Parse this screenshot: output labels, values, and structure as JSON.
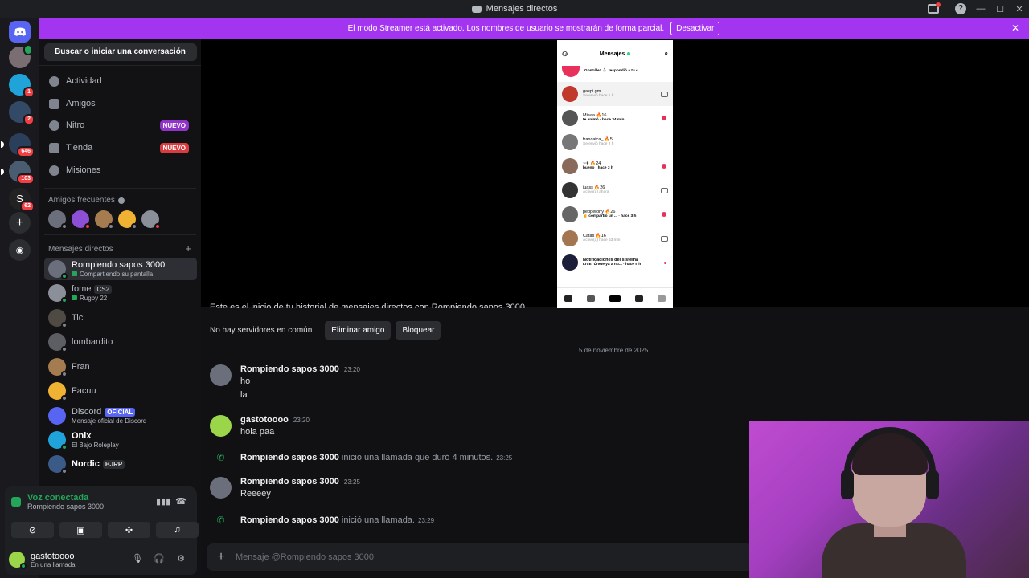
{
  "titlebar": {
    "title": "Mensajes directos"
  },
  "banner": {
    "text": "El modo Streamer está activado. Los nombres de usuario se mostrarán de forma parcial.",
    "button": "Desactivar",
    "close": "✕"
  },
  "guilds": {
    "badges": [
      "1",
      "2",
      "646",
      "103",
      "62"
    ]
  },
  "sidebar": {
    "search": "Buscar o iniciar una conversación",
    "nav": [
      {
        "label": "Actividad",
        "icon": "activity-icon"
      },
      {
        "label": "Amigos",
        "icon": "friends-icon"
      },
      {
        "label": "Nitro",
        "icon": "nitro-icon",
        "badge": "NUEVO"
      },
      {
        "label": "Tienda",
        "icon": "shop-icon",
        "badge": "NUEVO"
      },
      {
        "label": "Misiones",
        "icon": "quests-icon"
      }
    ],
    "frequent_title": "Amigos frecuentes",
    "dm_title": "Mensajes directos",
    "dms": [
      {
        "name": "Rompiendo sapos 3000",
        "sub": "Compartiendo su pantalla",
        "color": "#6b6f7b"
      },
      {
        "name": "fome",
        "tag": "CS2",
        "sub": "Rugby 22",
        "color": "#8b8f99"
      },
      {
        "name": "Tici",
        "sub": "",
        "color": "#4f4a44"
      },
      {
        "name": "lombardito",
        "sub": "",
        "color": "#5d5e63"
      },
      {
        "name": "Fran",
        "sub": "",
        "color": "#a57b50"
      },
      {
        "name": "Facuu",
        "sub": "",
        "color": "#f0b232"
      },
      {
        "name": "Discord",
        "tag": "OFICIAL",
        "sub": "Mensaje oficial de Discord",
        "color": "#5865f2"
      },
      {
        "name": "Onix",
        "sub": "El Bajo Roleplay",
        "color": "#1fa3d8"
      },
      {
        "name": "Nordic",
        "tag": "BJRP",
        "sub": "",
        "color": "#3a5b87"
      }
    ]
  },
  "voice": {
    "title": "Voz conectada",
    "channel": "Rompiendo sapos 3000"
  },
  "user": {
    "name": "gastotoooo",
    "status": "En una llamada"
  },
  "phone": {
    "title": "Mensajes",
    "rows": [
      {
        "name": "González ⛄ respondió a tu c...",
        "sub": "",
        "color": "#e8315a"
      },
      {
        "name": "gaspi.gm",
        "sub": "Se envió hace 1 h",
        "color": "#c0392b"
      },
      {
        "name": "Miaaa 🔥16",
        "sub": "te animó · hace 34 min",
        "color": "#555"
      },
      {
        "name": "francaica_ 🔥5",
        "sub": "Se envió hace 2 h",
        "color": "#777"
      },
      {
        "name": "~✈ 🔥24",
        "sub": "bueno · hace 3 h",
        "color": "#8a6a5a"
      },
      {
        "name": "juass 🔥26",
        "sub": "Activo(a) ahora",
        "color": "#333"
      },
      {
        "name": "pepperony 🔥26",
        "sub": "✌ compartió un ... · hace 3 h",
        "color": "#666"
      },
      {
        "name": "Catas 🔥16",
        "sub": "Activo(a) hace 53 min",
        "color": "#a47551"
      },
      {
        "name": "Notificaciones del sistema",
        "sub": "LIVE: Únete ya a nu... · hace 5 h",
        "color": "#1d1f3a"
      }
    ]
  },
  "conversation": {
    "intro": "Este es el inicio de tu historial de mensajes directos con Rompiendo sapos 3000.",
    "no_common": "No hay servidores en común",
    "remove_friend": "Eliminar amigo",
    "block": "Bloquear",
    "date": "5 de noviembre de 2025",
    "messages": [
      {
        "author": "Rompiendo sapos 3000",
        "time": "23:20",
        "lines": [
          "ho",
          "la"
        ]
      },
      {
        "author": "gastotoooo",
        "time": "23:20",
        "lines": [
          "hola paa"
        ]
      },
      {
        "author": "Rompiendo sapos 3000",
        "time": "23:25",
        "lines": [
          "Reeeey"
        ]
      }
    ],
    "calls": [
      {
        "who": "Rompiendo sapos 3000",
        "text": "inició una llamada que duró 4 minutos.",
        "time": "23:25"
      },
      {
        "who": "Rompiendo sapos 3000",
        "text": "inició una llamada.",
        "time": "23:29"
      }
    ],
    "composer_placeholder": "Mensaje @Rompiendo sapos 3000"
  },
  "colors": {
    "accent": "#5865f2",
    "banner": "#a335f1",
    "online": "#23a55a",
    "danger": "#f23f43"
  }
}
